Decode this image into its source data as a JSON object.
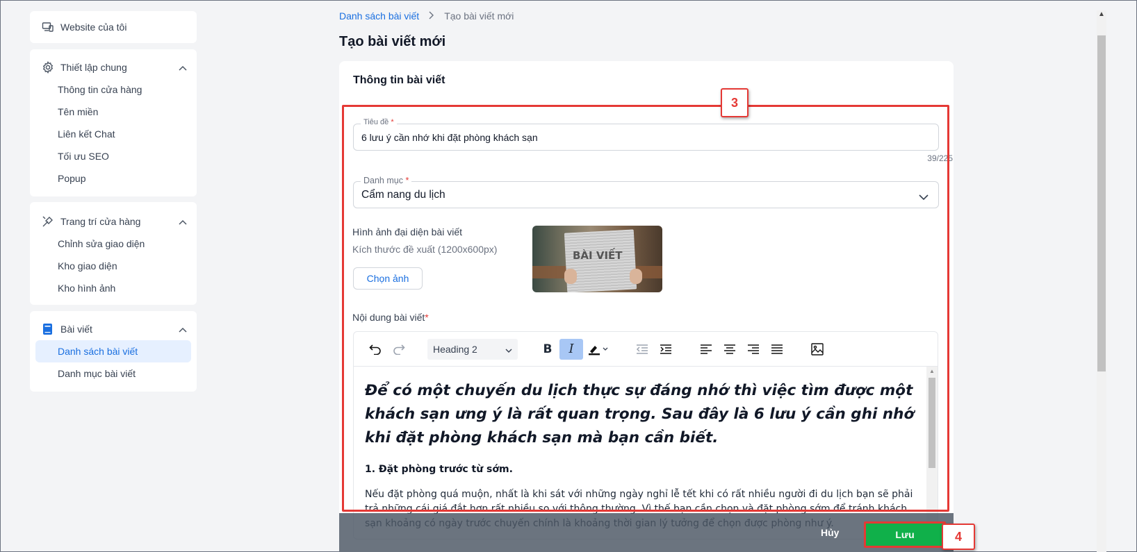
{
  "sidebar": {
    "website_label": "Website của tôi",
    "groups": [
      {
        "title": "Thiết lập chung",
        "icon": "gear-icon",
        "items": [
          "Thông tin cửa hàng",
          "Tên miền",
          "Liên kết Chat",
          "Tối ưu SEO",
          "Popup"
        ]
      },
      {
        "title": "Trang trí cửa hàng",
        "icon": "brush-icon",
        "items": [
          "Chỉnh sửa giao diện",
          "Kho giao diện",
          "Kho hình ảnh"
        ]
      },
      {
        "title": "Bài viết",
        "icon": "book-icon",
        "items": [
          "Danh sách bài viết",
          "Danh mục bài viết"
        ],
        "active_index": 0
      }
    ]
  },
  "breadcrumb": {
    "parent": "Danh sách bài viết",
    "current": "Tạo bài viết mới"
  },
  "page_title": "Tạo bài viết mới",
  "form": {
    "section_title": "Thông tin bài viết",
    "title_label": "Tiêu đề",
    "title_value": "6 lưu ý cần nhớ khi đặt phòng khách sạn",
    "title_counter": "39/225",
    "category_label": "Danh mục",
    "category_value": "Cẩm nang du lịch",
    "image_label": "Hình ảnh đại diện bài viết",
    "image_hint": "Kích thước đề xuất (1200x600px)",
    "choose_image": "Chọn ảnh",
    "thumbnail_text": "BÀI VIẾT",
    "content_label": "Nội dung bài viết",
    "required_mark": "*"
  },
  "editor": {
    "heading_select": "Heading 2",
    "heading_text": "Để có một chuyến du lịch thực sự đáng nhớ thì việc tìm được một khách sạn ưng ý là rất quan trọng. Sau đây là 6 lưu ý cần ghi nhớ khi đặt phòng khách sạn mà bạn cần biết.",
    "subheading": "1. Đặt phòng trước từ sớm.",
    "paragraph": "Nếu đặt phòng quá muộn, nhất là khi sát với những ngày nghỉ lễ tết khi có rất nhiều người đi du lịch bạn sẽ phải trả những cái giá đắt hơn rất nhiều so với thông thường. Vì thế bạn cần chọn và đặt phòng sớm để tránh khách sạn khoảng có ngày trước chuyến chính là khoảng thời gian lý tưởng để chọn được phòng như ý."
  },
  "footer": {
    "cancel": "Hủy",
    "save": "Lưu"
  },
  "annotations": {
    "step_3": "3",
    "step_4": "4"
  },
  "colors": {
    "accent": "#1a6fe0",
    "save": "#10b04a",
    "highlight": "#e53935"
  }
}
